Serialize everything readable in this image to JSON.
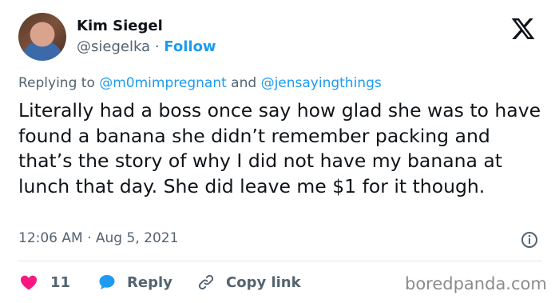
{
  "author": {
    "name": "Kim Siegel",
    "handle": "@siegelka",
    "separator": "·",
    "follow_label": "Follow"
  },
  "reply_context": {
    "prefix": "Replying to",
    "mention_1": "@m0mimpregnant",
    "joiner": "and",
    "mention_2": "@jensayingthings"
  },
  "tweet": {
    "text": "Literally had a boss once say how glad she was to have found a banana she didn’t remember packing and that’s the story of why I did not have my banana at lunch that day. She did leave me $1 for it though.",
    "timestamp": "12:06 AM · Aug 5, 2021"
  },
  "actions": {
    "like_count": "11",
    "reply_label": "Reply",
    "copy_link_label": "Copy link"
  },
  "watermark": "boredpanda.com",
  "icons": {
    "platform": "x-logo-icon",
    "info": "info-icon",
    "like": "heart-icon",
    "reply": "speech-bubble-icon",
    "copy": "link-icon"
  },
  "colors": {
    "accent": "#1d9bf0",
    "like": "#f91880",
    "text": "#0f1419",
    "muted": "#536471"
  }
}
